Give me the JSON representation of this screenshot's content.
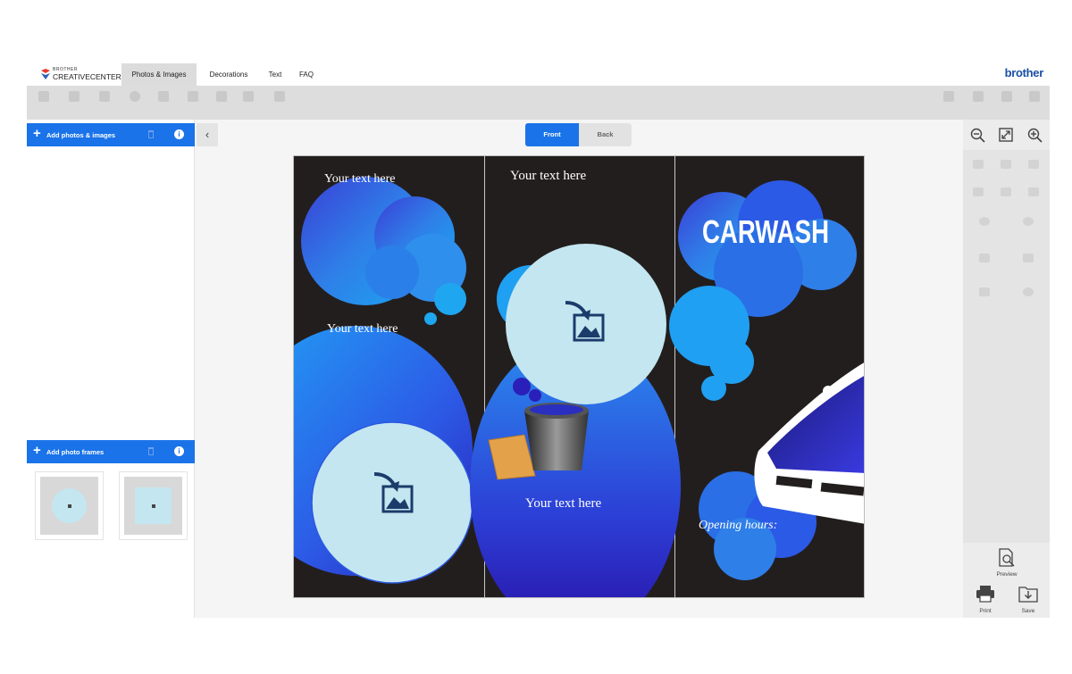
{
  "app": {
    "logo_small": "BROTHER",
    "logo_main": "CREATIVECENTER",
    "brand": "brother",
    "tabs": [
      {
        "label": "Photos & Images",
        "active": true
      },
      {
        "label": "Decorations",
        "active": false
      },
      {
        "label": "Text",
        "active": false
      },
      {
        "label": "FAQ",
        "active": false
      }
    ]
  },
  "left_panel": {
    "photos_header": "Add photos & images",
    "frames_header": "Add photo frames"
  },
  "view_toggle": {
    "front": "Front",
    "back": "Back",
    "active": "Front"
  },
  "document": {
    "panel1_text_top": "Your text here",
    "panel1_text_mid": "Your text here",
    "panel2_text_top": "Your text here",
    "panel2_text_bottom": "Your text here",
    "panel3_title": "CARWASH",
    "panel3_hours": "Opening hours:"
  },
  "right_panel": {
    "preview": "Preview",
    "print": "Print",
    "save": "Save"
  },
  "colors": {
    "accent": "#1a73e8",
    "doc_bg": "#231e1e",
    "photo_placeholder": "#c4e6f0",
    "brand": "#1a4fa3"
  }
}
